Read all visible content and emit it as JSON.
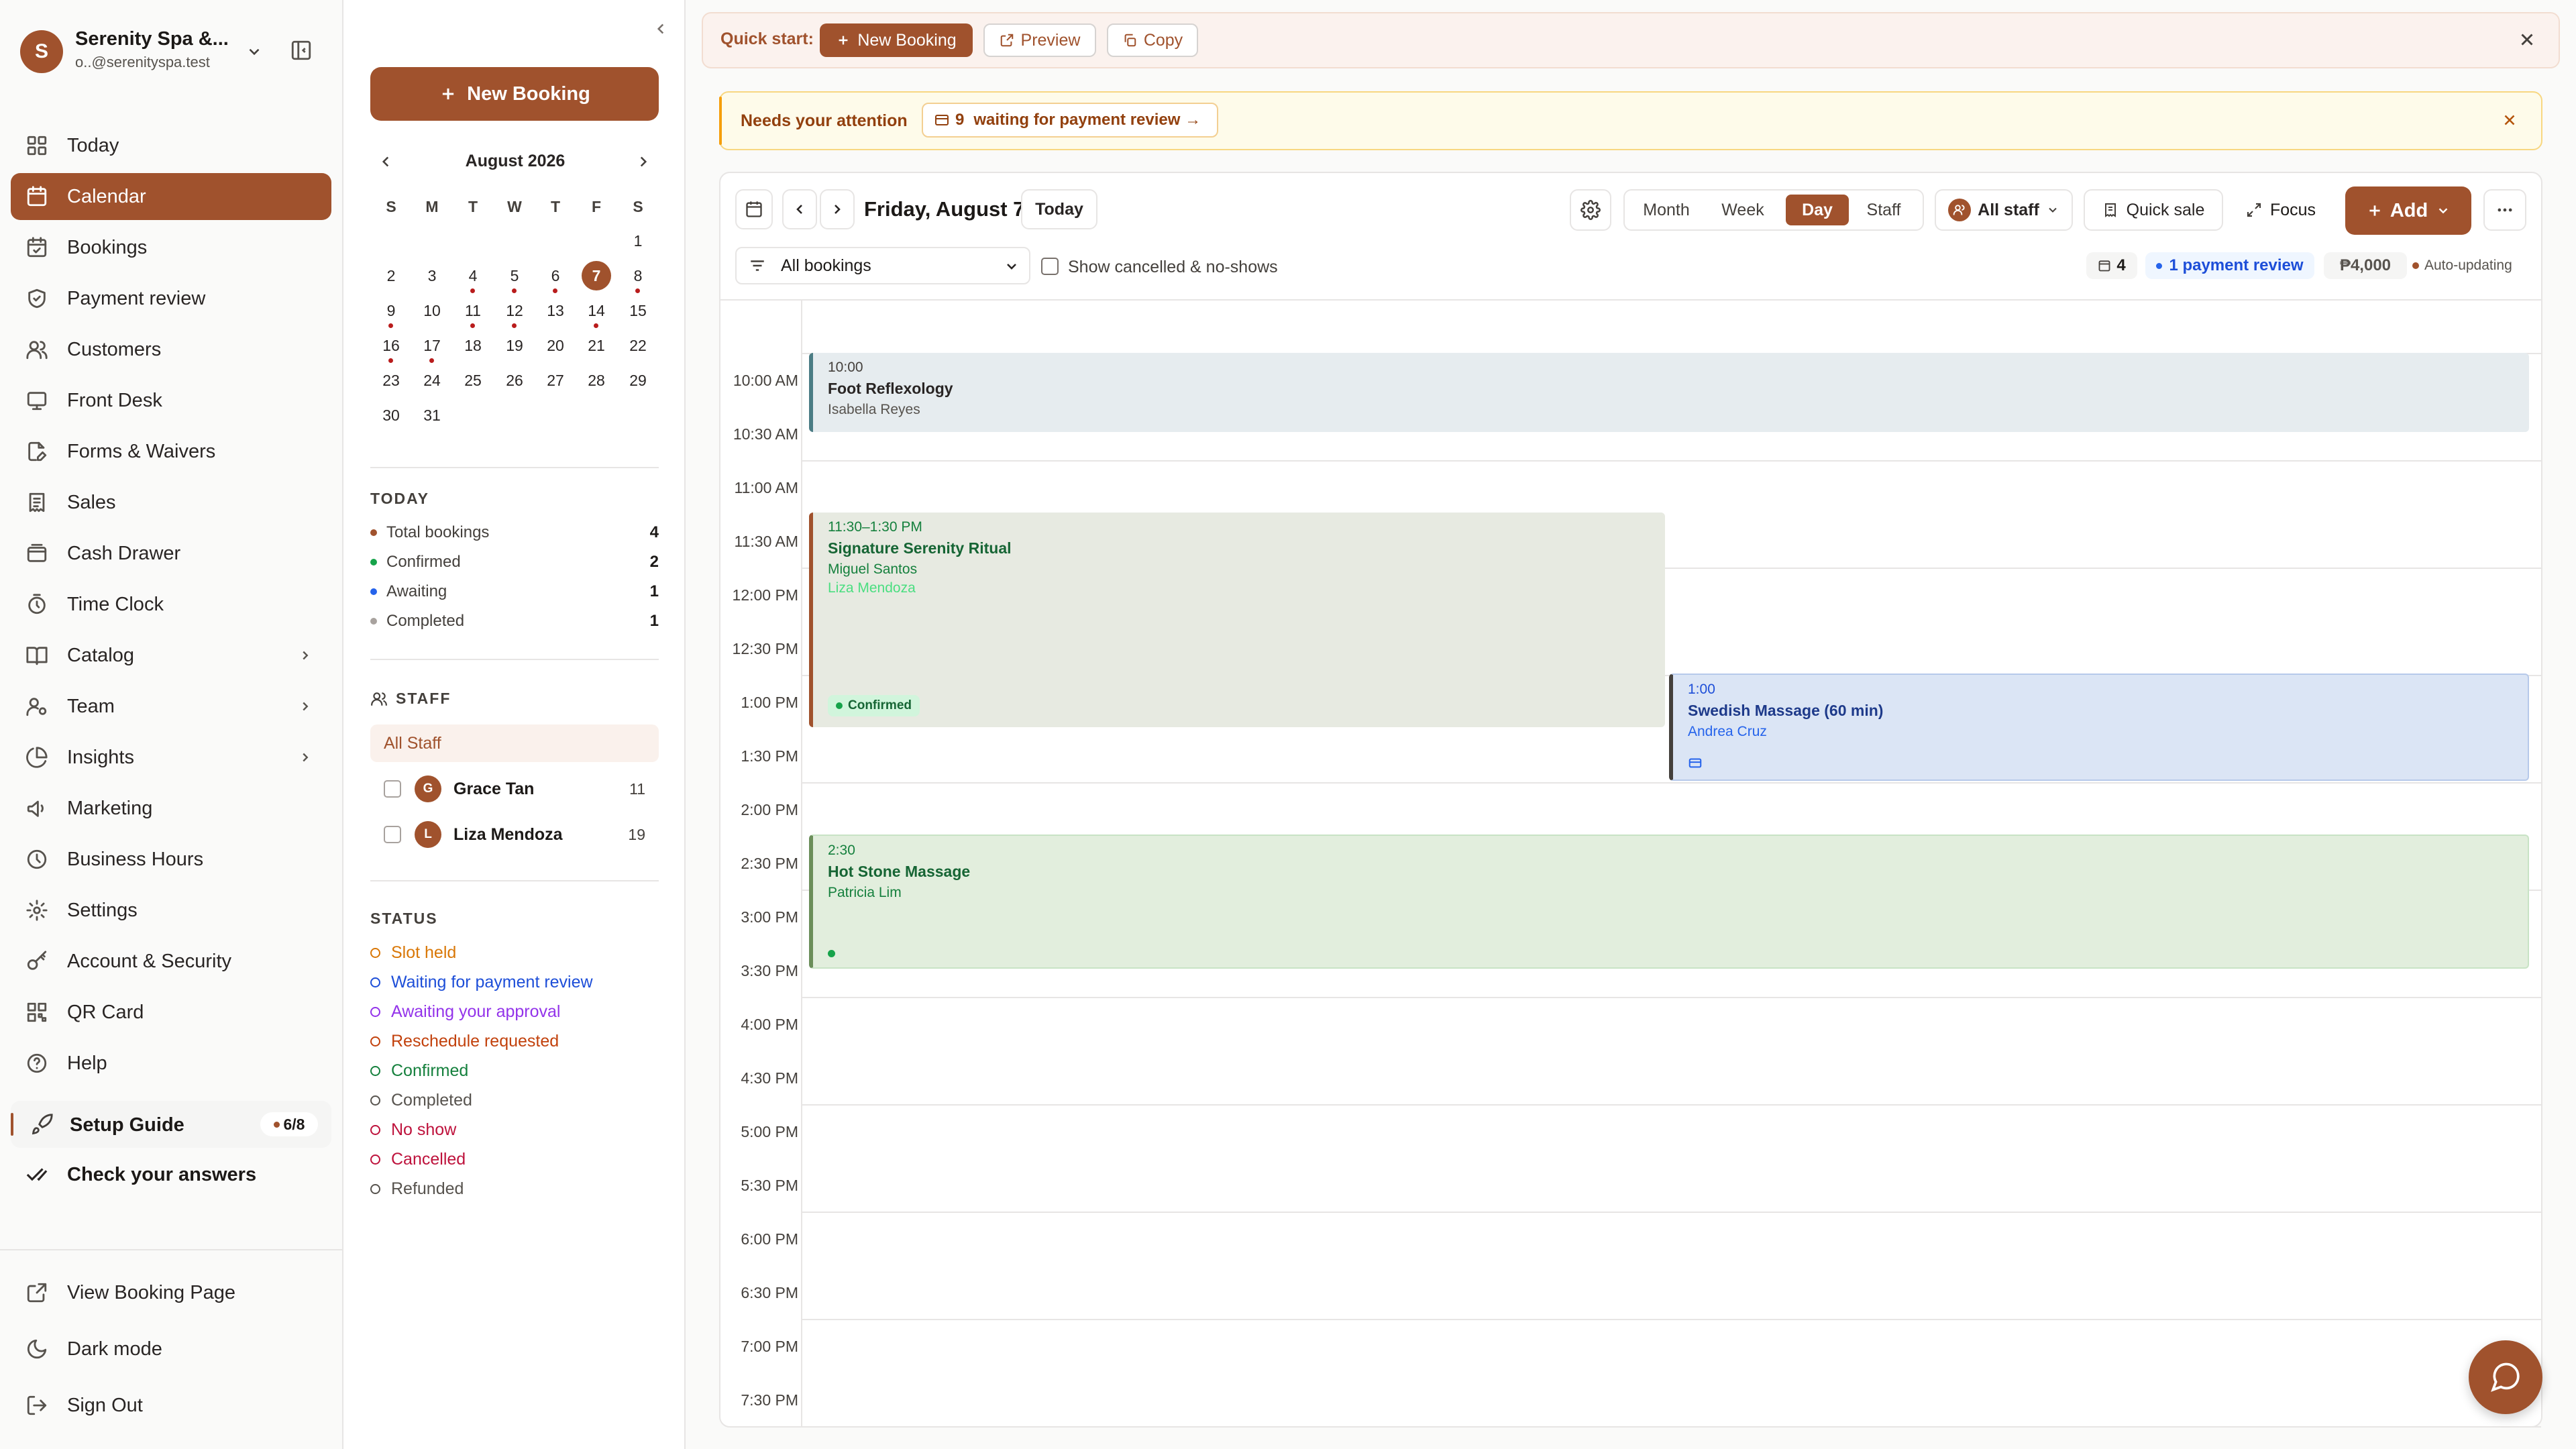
{
  "sidebar": {
    "business_name": "Serenity Spa &...",
    "email": "o..@serenityspa.test",
    "avatar_letter": "S",
    "nav": [
      {
        "label": "Today",
        "icon": "grid-icon"
      },
      {
        "label": "Calendar",
        "icon": "calendar-icon"
      },
      {
        "label": "Bookings",
        "icon": "calendar-check-icon"
      },
      {
        "label": "Payment review",
        "icon": "shield-icon"
      },
      {
        "label": "Customers",
        "icon": "users-icon"
      },
      {
        "label": "Front Desk",
        "icon": "monitor-icon"
      },
      {
        "label": "Forms & Waivers",
        "icon": "file-edit-icon"
      },
      {
        "label": "Sales",
        "icon": "receipt-icon"
      },
      {
        "label": "Cash Drawer",
        "icon": "wallet-icon"
      },
      {
        "label": "Time Clock",
        "icon": "timer-icon"
      },
      {
        "label": "Catalog",
        "icon": "book-icon"
      },
      {
        "label": "Team",
        "icon": "user-cog-icon"
      },
      {
        "label": "Insights",
        "icon": "pie-chart-icon"
      },
      {
        "label": "Marketing",
        "icon": "megaphone-icon"
      },
      {
        "label": "Business Hours",
        "icon": "clock-icon"
      },
      {
        "label": "Settings",
        "icon": "gear-icon"
      },
      {
        "label": "Account & Security",
        "icon": "key-icon"
      },
      {
        "label": "QR Card",
        "icon": "qr-icon"
      },
      {
        "label": "Help",
        "icon": "help-icon"
      }
    ],
    "setup_guide": {
      "label": "Setup Guide",
      "progress": "6/8"
    },
    "check_answers": "Check your answers",
    "footer": [
      {
        "label": "View Booking Page",
        "icon": "external-link-icon"
      },
      {
        "label": "Dark mode",
        "icon": "moon-icon"
      },
      {
        "label": "Sign Out",
        "icon": "sign-out-icon"
      }
    ]
  },
  "panel": {
    "new_booking": "New Booking",
    "month_label": "August 2026",
    "weekdays": [
      "S",
      "M",
      "T",
      "W",
      "T",
      "F",
      "S"
    ],
    "days": [
      [
        "",
        "",
        "",
        "",
        "",
        "",
        "1"
      ],
      [
        "2",
        "3",
        "4",
        "5",
        "6",
        "7",
        "8"
      ],
      [
        "9",
        "10",
        "11",
        "12",
        "13",
        "14",
        "15"
      ],
      [
        "16",
        "17",
        "18",
        "19",
        "20",
        "21",
        "22"
      ],
      [
        "23",
        "24",
        "25",
        "26",
        "27",
        "28",
        "29"
      ],
      [
        "30",
        "31",
        "",
        "",
        "",
        "",
        ""
      ]
    ],
    "selected_day": "7",
    "dot_days": [
      "4",
      "5",
      "6",
      "8",
      "9",
      "11",
      "12",
      "14",
      "16",
      "17"
    ],
    "today": {
      "heading": "TODAY",
      "rows": [
        {
          "label": "Total bookings",
          "count": "4",
          "color": "#a0522d"
        },
        {
          "label": "Confirmed",
          "count": "2",
          "color": "#16a34a"
        },
        {
          "label": "Awaiting",
          "count": "1",
          "color": "#2563eb"
        },
        {
          "label": "Completed",
          "count": "1",
          "color": "#a8a29e"
        }
      ]
    },
    "staff": {
      "heading": "STAFF",
      "all_label": "All Staff",
      "members": [
        {
          "initial": "G",
          "name": "Grace Tan",
          "count": "11"
        },
        {
          "initial": "L",
          "name": "Liza Mendoza",
          "count": "19"
        }
      ]
    },
    "status": {
      "heading": "STATUS",
      "items": [
        {
          "label": "Slot held",
          "color": "#d97706"
        },
        {
          "label": "Waiting for payment review",
          "color": "#1d4ed8"
        },
        {
          "label": "Awaiting your approval",
          "color": "#9333ea"
        },
        {
          "label": "Reschedule requested",
          "color": "#c2410c"
        },
        {
          "label": "Confirmed",
          "color": "#15803d"
        },
        {
          "label": "Completed",
          "color": "#57534e"
        },
        {
          "label": "No show",
          "color": "#be123c"
        },
        {
          "label": "Cancelled",
          "color": "#be123c"
        },
        {
          "label": "Refunded",
          "color": "#57534e"
        }
      ]
    }
  },
  "quickstart": {
    "label": "Quick start:",
    "new_booking": "New Booking",
    "preview": "Preview",
    "copy": "Copy"
  },
  "attention": {
    "label": "Needs your attention",
    "count": "9",
    "text": "waiting for payment review →"
  },
  "toolbar": {
    "date_label": "Friday, August 7",
    "today": "Today",
    "views": [
      "Month",
      "Week",
      "Day",
      "Staff"
    ],
    "active_view": "Day",
    "staff_filter": "All staff",
    "quick_sale": "Quick sale",
    "focus": "Focus",
    "add": "Add",
    "filter_select": "All bookings",
    "show_cancelled": "Show cancelled & no-shows",
    "booking_count": "4",
    "payment_review": "1 payment review",
    "total": "₱4,000",
    "auto_updating": "Auto-updating"
  },
  "times": [
    "10:00 AM",
    "10:30 AM",
    "11:00 AM",
    "11:30 AM",
    "12:00 PM",
    "12:30 PM",
    "1:00 PM",
    "1:30 PM",
    "2:00 PM",
    "2:30 PM",
    "3:00 PM",
    "3:30 PM",
    "4:00 PM",
    "4:30 PM",
    "5:00 PM",
    "5:30 PM",
    "6:00 PM",
    "6:30 PM",
    "7:00 PM",
    "7:30 PM"
  ],
  "events": [
    {
      "time": "10:00",
      "name": "Foot Reflexology",
      "person": "Isabella Reyes"
    },
    {
      "time": "11:30–1:30 PM",
      "name": "Signature Serenity Ritual",
      "person": "Miguel Santos",
      "staff": "Liza Mendoza",
      "badge": "Confirmed"
    },
    {
      "time": "1:00",
      "name": "Swedish Massage (60 min)",
      "person": "Andrea Cruz"
    },
    {
      "time": "2:30",
      "name": "Hot Stone Massage",
      "person": "Patricia Lim"
    }
  ],
  "colors": {
    "accent": "#a0522d",
    "confirmed": "#16a34a",
    "review": "#2563eb"
  }
}
